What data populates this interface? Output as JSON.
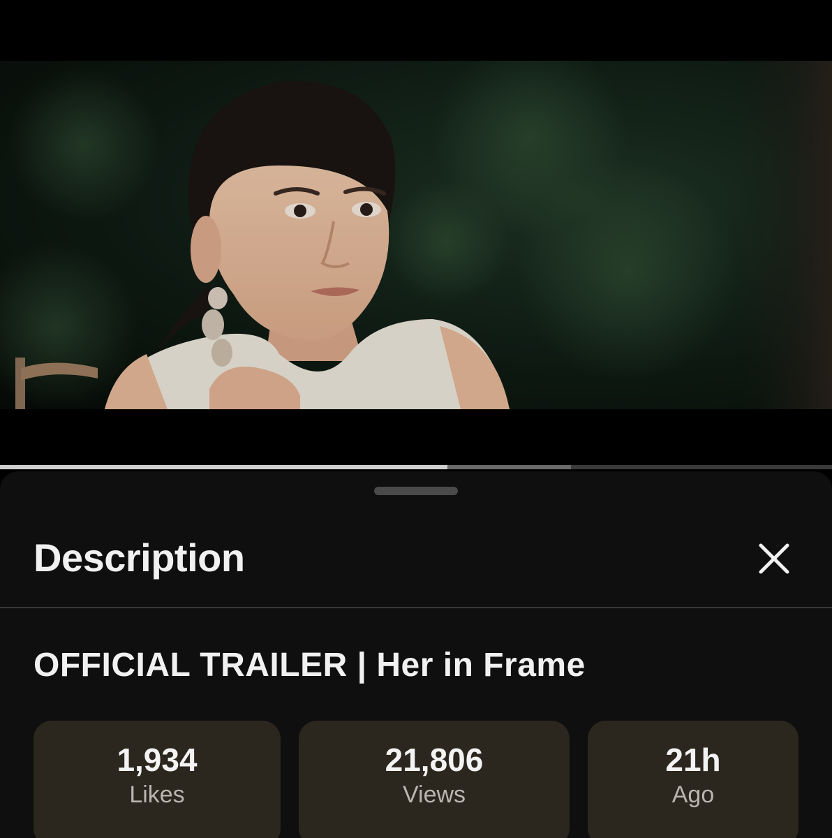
{
  "player": {
    "progress_played_fraction": 0.538,
    "progress_buffered_fraction": 0.686,
    "icons": {
      "close": "close-icon"
    }
  },
  "sheet": {
    "title": "Description",
    "video_title": "OFFICIAL TRAILER | Her in Frame",
    "stats": [
      {
        "value": "1,934",
        "label": "Likes"
      },
      {
        "value": "21,806",
        "label": "Views"
      },
      {
        "value": "21h",
        "label": "Ago"
      }
    ]
  },
  "colors": {
    "sheet_background": "#0f0f0f",
    "stat_chip_background": "#2b261e",
    "progress_played": "#cfcfcf",
    "progress_buffer": "#6a6a6a",
    "progress_track": "#3a3a3a"
  }
}
